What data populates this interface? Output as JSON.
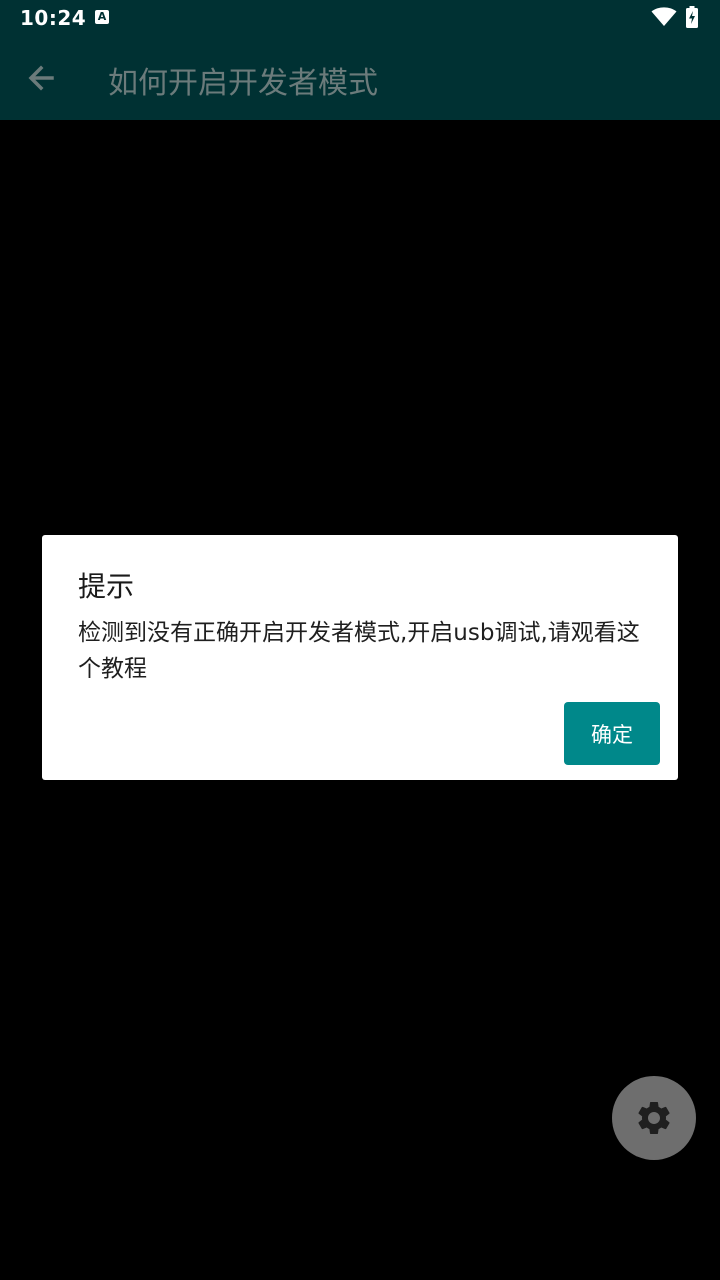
{
  "status_bar": {
    "time": "10:24",
    "notification_icon": "a-icon",
    "wifi_icon": "wifi-icon",
    "battery_icon": "battery-charging-icon"
  },
  "app_bar": {
    "back_icon": "back-arrow-icon",
    "title": "如何开启开发者模式"
  },
  "dialog": {
    "title": "提示",
    "message": "检测到没有正确开启开发者模式,开启usb调试,请观看这个教程",
    "ok_label": "确定"
  },
  "fab": {
    "icon": "gear-icon"
  },
  "colors": {
    "status_bar_bg": "#003133",
    "app_bar_bg": "#003133",
    "app_title": "#6b7b7b",
    "background": "#000000",
    "dialog_bg": "#ffffff",
    "accent": "#00888a",
    "fab_bg": "#6e6e6e",
    "fab_icon": "#1f1f1f"
  }
}
